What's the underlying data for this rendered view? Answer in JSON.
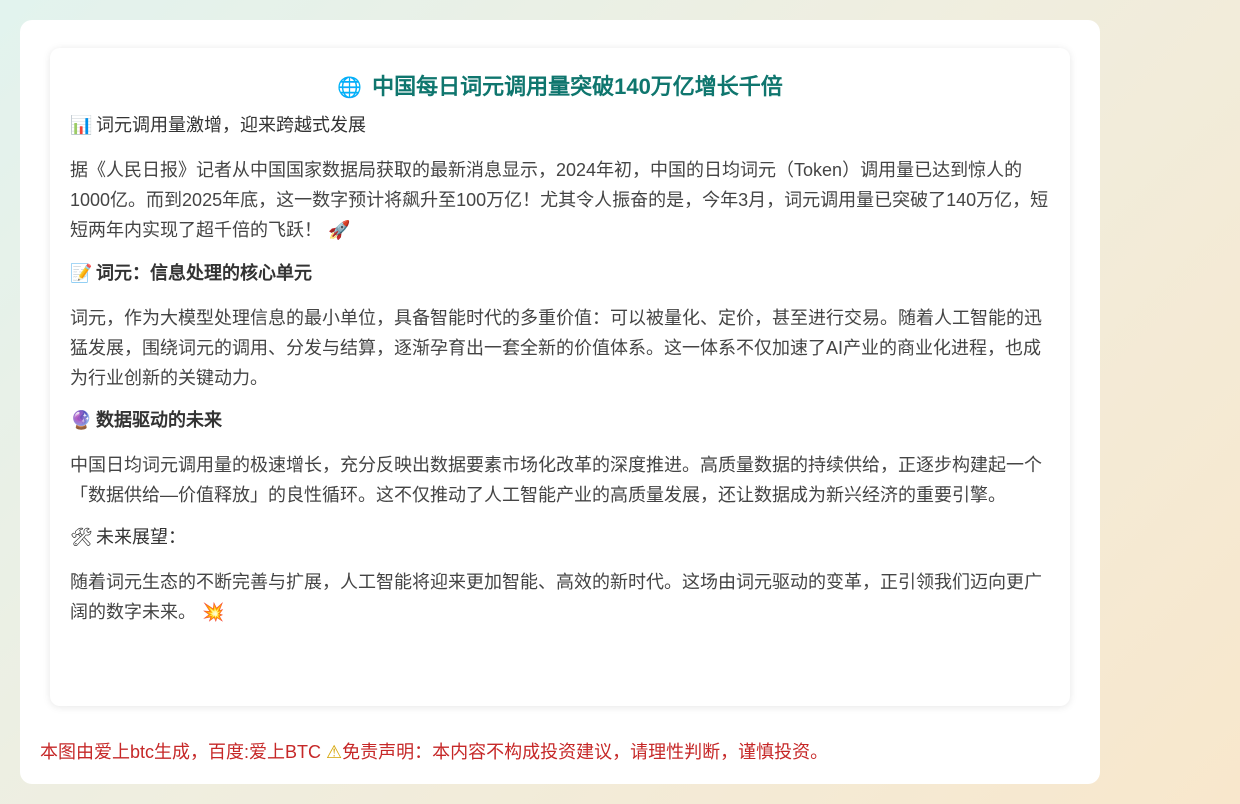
{
  "article": {
    "title_icon": "globe-icon",
    "title_icon_glyph": "🌐",
    "title": "中国每日词元调用量突破140万亿增长千倍",
    "sections": [
      {
        "icon": "bar-chart-icon",
        "icon_glyph": "📊",
        "heading": "词元调用量激增，迎来跨越式发展",
        "body": "据《人民日报》记者从中国国家数据局获取的最新消息显示，2024年初，中国的日均词元（Token）调用量已达到惊人的1000亿。而到2025年底，这一数字预计将飙升至100万亿！尤其令人振奋的是，今年3月，词元调用量已突破了140万亿，短短两年内实现了超千倍的飞跃！",
        "body_icon": "rocket-icon",
        "body_icon_glyph": "🚀"
      },
      {
        "icon": "memo-icon",
        "icon_glyph": "📝",
        "heading": "词元：信息处理的核心单元",
        "body": "词元，作为大模型处理信息的最小单位，具备智能时代的多重价值：可以被量化、定价，甚至进行交易。随着人工智能的迅猛发展，围绕词元的调用、分发与结算，逐渐孕育出一套全新的价值体系。这一体系不仅加速了AI产业的商业化进程，也成为行业创新的关键动力。"
      },
      {
        "icon": "crystal-ball-icon",
        "icon_glyph": "🔮",
        "heading": "数据驱动的未来",
        "body": "中国日均词元调用量的极速增长，充分反映出数据要素市场化改革的深度推进。高质量数据的持续供给，正逐步构建起一个「数据供给—价值释放」的良性循环。这不仅推动了人工智能产业的高质量发展，还让数据成为新兴经济的重要引擎。"
      },
      {
        "icon": "tools-icon",
        "icon_glyph": "🛠",
        "heading": "未来展望：",
        "body": "随着词元生态的不断完善与扩展，人工智能将迎来更加智能、高效的新时代。这场由词元驱动的变革，正引领我们迈向更广阔的数字未来。",
        "body_icon": "sparkle-icon",
        "body_icon_glyph": "💥"
      }
    ]
  },
  "footer": {
    "credit": "本图由爱上btc生成，百度:爱上BTC",
    "warning_icon": "warning-icon",
    "warning_icon_glyph": "⚠",
    "disclaimer": "免责声明：本内容不构成投资建议，请理性判断，谨慎投资。"
  },
  "colors": {
    "title": "#0f766e",
    "footer_text": "#c62828",
    "background_start": "#e2f3ee",
    "background_end": "#f8e7cc"
  }
}
